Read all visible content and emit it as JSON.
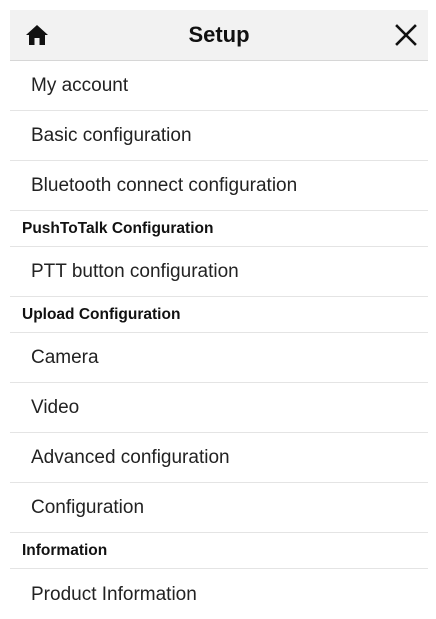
{
  "header": {
    "title": "Setup",
    "home_icon": "home-icon",
    "close_icon": "close-icon"
  },
  "menu": {
    "my_account": "My account",
    "basic_configuration": "Basic configuration",
    "bluetooth_connect_configuration": "Bluetooth connect configuration",
    "section_pushtotalk": "PushToTalk Configuration",
    "ptt_button_configuration": "PTT button configuration",
    "section_upload": "Upload Configuration",
    "camera": "Camera",
    "video": "Video",
    "advanced_configuration": "Advanced configuration",
    "configuration": "Configuration",
    "section_information": "Information",
    "product_information": "Product Information"
  }
}
